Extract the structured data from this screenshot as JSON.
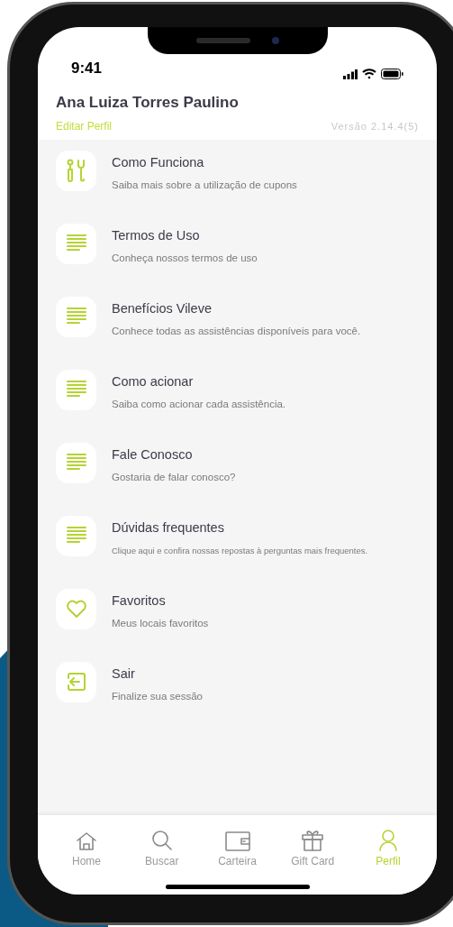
{
  "status_bar": {
    "time": "9:41"
  },
  "profile": {
    "name": "Ana Luiza Torres Paulino",
    "edit_link": "Editar Perfil",
    "version": "Versão 2.14.4(5)"
  },
  "menu": [
    {
      "kind": "tools",
      "title": "Como Funciona",
      "subtitle": "Saiba mais sobre a utilização de cupons",
      "small": false
    },
    {
      "kind": "document",
      "title": "Termos de Uso",
      "subtitle": "Conheça nossos termos de uso",
      "small": false
    },
    {
      "kind": "document",
      "title": "Benefícios Vileve",
      "subtitle": "Conhece todas as assistências disponíveis para você.",
      "small": false
    },
    {
      "kind": "document",
      "title": "Como acionar",
      "subtitle": "Saiba como acionar cada assistência.",
      "small": false
    },
    {
      "kind": "document",
      "title": "Fale Conosco",
      "subtitle": "Gostaria de falar conosco?",
      "small": false
    },
    {
      "kind": "document",
      "title": "Dúvidas frequentes",
      "subtitle": "Clique aqui e confira nossas repostas à perguntas mais frequentes.",
      "small": true
    },
    {
      "kind": "heart",
      "title": "Favoritos",
      "subtitle": "Meus locais favoritos",
      "small": false
    },
    {
      "kind": "logout",
      "title": "Sair",
      "subtitle": "Finalize sua sessão",
      "small": false
    }
  ],
  "tab_bar": [
    {
      "kind": "home",
      "label": "Home",
      "selected": false
    },
    {
      "kind": "search",
      "label": "Buscar",
      "selected": false
    },
    {
      "kind": "wallet",
      "label": "Carteira",
      "selected": false
    },
    {
      "kind": "gift",
      "label": "Gift Card",
      "selected": false
    },
    {
      "kind": "user",
      "label": "Perfil",
      "selected": true
    }
  ]
}
